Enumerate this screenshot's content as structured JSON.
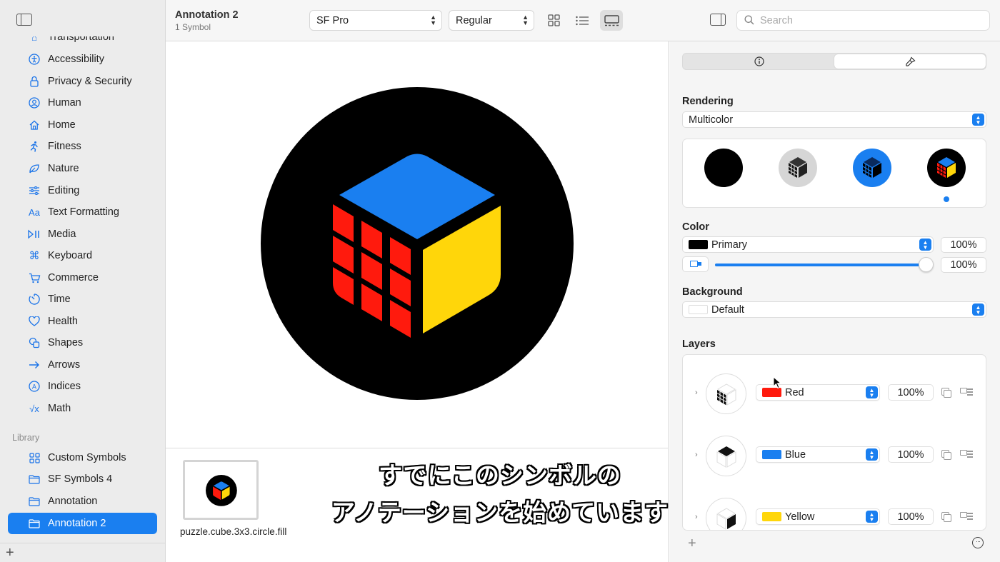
{
  "sidebar": {
    "items": [
      {
        "label": "Transportation",
        "icon": "car-icon"
      },
      {
        "label": "Accessibility",
        "icon": "accessibility-icon"
      },
      {
        "label": "Privacy & Security",
        "icon": "lock-icon"
      },
      {
        "label": "Human",
        "icon": "person-icon"
      },
      {
        "label": "Home",
        "icon": "house-icon"
      },
      {
        "label": "Fitness",
        "icon": "figure-run-icon"
      },
      {
        "label": "Nature",
        "icon": "leaf-icon"
      },
      {
        "label": "Editing",
        "icon": "slider-icon"
      },
      {
        "label": "Text Formatting",
        "icon": "textformat-icon"
      },
      {
        "label": "Media",
        "icon": "playpause-icon"
      },
      {
        "label": "Keyboard",
        "icon": "command-icon"
      },
      {
        "label": "Commerce",
        "icon": "cart-icon"
      },
      {
        "label": "Time",
        "icon": "timer-icon"
      },
      {
        "label": "Health",
        "icon": "heart-icon"
      },
      {
        "label": "Shapes",
        "icon": "shapes-icon"
      },
      {
        "label": "Arrows",
        "icon": "arrow-right-icon"
      },
      {
        "label": "Indices",
        "icon": "a-circle-icon"
      },
      {
        "label": "Math",
        "icon": "squareroot-icon"
      }
    ],
    "library_label": "Library",
    "library": [
      {
        "label": "Custom Symbols",
        "icon": "grid-icon"
      },
      {
        "label": "SF Symbols 4",
        "icon": "folder-icon"
      },
      {
        "label": "Annotation",
        "icon": "folder-icon"
      },
      {
        "label": "Annotation 2",
        "icon": "folder-icon",
        "selected": true
      }
    ],
    "add_label": "+"
  },
  "toolbar": {
    "title": "Annotation 2",
    "subtitle": "1 Symbol",
    "font": "SF Pro",
    "weight": "Regular",
    "search_placeholder": "Search"
  },
  "canvas": {
    "symbol_name": "puzzle.cube.3x3.circle.fill",
    "colors": {
      "background": "#000000",
      "blue": "#1a7ff0",
      "red": "#ff1a0d",
      "yellow": "#ffd60a"
    }
  },
  "subtitle": {
    "line1": "すでにこのシンボルの",
    "line2": "アノテーションを始めています"
  },
  "inspector": {
    "tabs": [
      {
        "icon": "info-icon"
      },
      {
        "icon": "paintbrush-icon",
        "active": true
      }
    ],
    "rendering_title": "Rendering",
    "rendering_value": "Multicolor",
    "color_title": "Color",
    "color_value": "Primary",
    "color_opacity": "100%",
    "slider_opacity": "100%",
    "slider_level": 1.0,
    "background_title": "Background",
    "background_value": "Default",
    "layers_title": "Layers",
    "layers": [
      {
        "name": "Red",
        "color": "#ff1a0d",
        "opacity": "100%"
      },
      {
        "name": "Blue",
        "color": "#1a7ff0",
        "opacity": "100%"
      },
      {
        "name": "Yellow",
        "color": "#ffd60a",
        "opacity": "100%"
      }
    ],
    "add_label": "+",
    "more_label": "···"
  }
}
